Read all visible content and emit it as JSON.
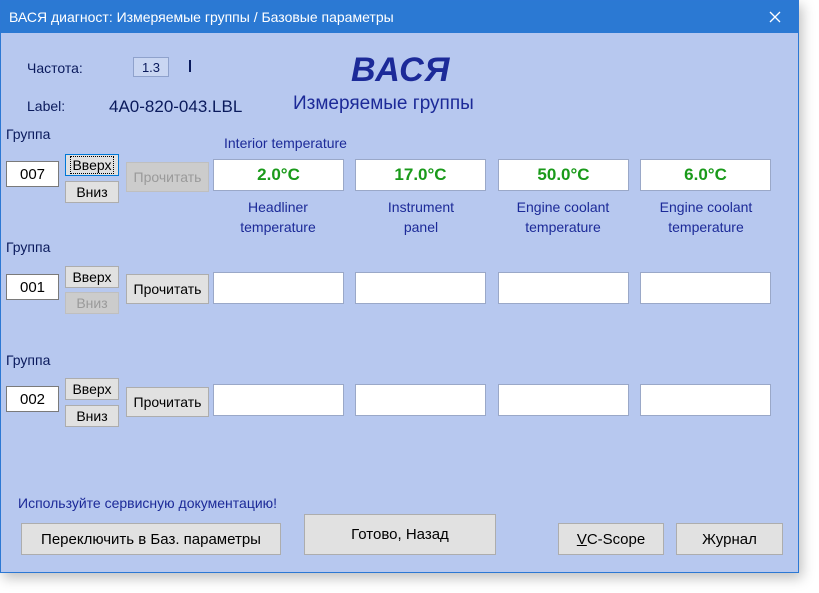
{
  "window": {
    "title": "ВАСЯ диагност: Измеряемые группы / Базовые параметры"
  },
  "header": {
    "freq_label": "Частота:",
    "freq_value": "1.3",
    "label_label": "Label:",
    "label_value": "4A0-820-043.LBL",
    "brand": "ВАСЯ",
    "subtitle": "Измеряемые группы"
  },
  "groups": [
    {
      "label": "Группа",
      "number": "007",
      "up": "Вверх",
      "down": "Вниз",
      "read": "Прочитать",
      "group_title": "Interior temperature",
      "values": [
        "2.0°C",
        "17.0°C",
        "50.0°C",
        "6.0°C"
      ],
      "captions": [
        [
          "Headliner",
          "temperature"
        ],
        [
          "Instrument",
          "panel"
        ],
        [
          "Engine coolant",
          "temperature"
        ],
        [
          "Engine coolant",
          "temperature"
        ]
      ]
    },
    {
      "label": "Группа",
      "number": "001",
      "up": "Вверх",
      "down": "Вниз",
      "read": "Прочитать",
      "values": [
        "",
        "",
        "",
        ""
      ]
    },
    {
      "label": "Группа",
      "number": "002",
      "up": "Вверх",
      "down": "Вниз",
      "read": "Прочитать",
      "values": [
        "",
        "",
        "",
        ""
      ]
    }
  ],
  "footer": {
    "hint": "Используйте сервисную документацию!",
    "switch_button": "Переключить в Баз. параметры",
    "done_button": "Готово, Назад",
    "vcscope_underlined": "V",
    "vcscope_rest": "C-Scope",
    "log_button": "Журнал"
  },
  "icons": {
    "close": "close-icon"
  },
  "colors": {
    "titlebar": "#2b79d3",
    "background": "#b7c8ef",
    "value_text": "#1a9a1a",
    "label_text": "#1c2a98"
  }
}
